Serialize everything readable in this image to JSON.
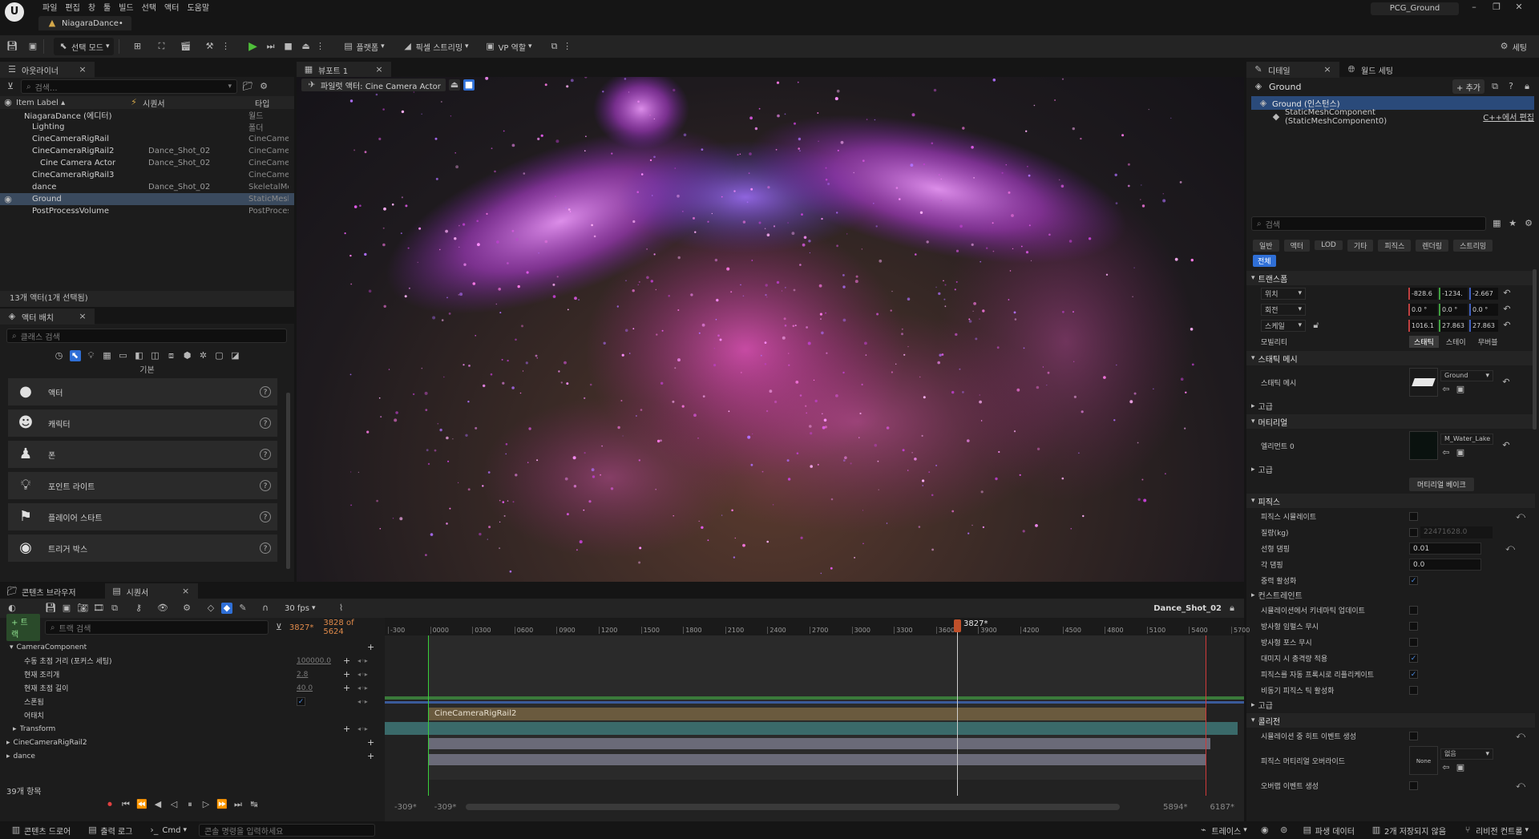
{
  "menu": {
    "items": [
      "파일",
      "편집",
      "창",
      "툴",
      "빌드",
      "선택",
      "액터",
      "도움말"
    ],
    "project": "PCG_Ground",
    "map_tab": "NiagaraDance•"
  },
  "toolbar": {
    "select_mode": "선택 모드",
    "platforms": "플랫폼",
    "pixel_streaming": "픽셀 스트리밍",
    "vp_role": "VP 역할",
    "settings": "세팅"
  },
  "outliner": {
    "tab": "아웃라이너",
    "search_placeholder": "검색...",
    "col_label": "Item Label ▴",
    "col_sequencer": "시퀀서",
    "col_type": "타입",
    "rows": [
      {
        "label": "NiagaraDance (에디터)",
        "seq": "",
        "type": "월드",
        "indent": 0,
        "selected": false
      },
      {
        "label": "Lighting",
        "seq": "",
        "type": "폴더",
        "indent": 1,
        "selected": false
      },
      {
        "label": "CineCameraRigRail",
        "seq": "",
        "type": "CineCamera",
        "indent": 1,
        "selected": false
      },
      {
        "label": "CineCameraRigRail2",
        "seq": "Dance_Shot_02",
        "type": "CineCamera",
        "indent": 1,
        "selected": false
      },
      {
        "label": "Cine Camera Actor",
        "seq": "Dance_Shot_02",
        "type": "CineCamera",
        "indent": 2,
        "selected": false
      },
      {
        "label": "CineCameraRigRail3",
        "seq": "",
        "type": "CineCamera",
        "indent": 1,
        "selected": false
      },
      {
        "label": "dance",
        "seq": "Dance_Shot_02",
        "type": "SkeletalMe",
        "indent": 1,
        "selected": false
      },
      {
        "label": "Ground",
        "seq": "",
        "type": "StaticMesh",
        "indent": 1,
        "selected": true
      },
      {
        "label": "PostProcessVolume",
        "seq": "",
        "type": "PostProces",
        "indent": 1,
        "selected": false
      }
    ],
    "status": "13개 액터(1개 선택됨)"
  },
  "place_actors": {
    "tab": "액터 배치",
    "search_placeholder": "클래스 검색",
    "category": "기본",
    "items": [
      "액터",
      "캐릭터",
      "폰",
      "포인트 라이트",
      "플레이어 스타트",
      "트리거 박스"
    ]
  },
  "viewport": {
    "tab": "뷰포트 1",
    "pilot_label": "파일럿 액터: Cine Camera Actor"
  },
  "details": {
    "tab": "디테일",
    "tab2": "월드 세팅",
    "actor_name": "Ground",
    "add_label": "+ 추가",
    "instance": "Ground (인스턴스)",
    "component": "StaticMeshComponent (StaticMeshComponent0)",
    "cpp_link": "C++에서 편집",
    "search_placeholder": "검색",
    "filters": [
      "일반",
      "액터",
      "LOD",
      "기타",
      "피직스",
      "렌더링",
      "스트리밍"
    ],
    "filter_all": "전체",
    "sections": {
      "transform": "트랜스폼",
      "location": "위치",
      "rotation": "회전",
      "scale": "스케일",
      "mobility": "모빌리티",
      "mobility_opts": [
        "스태틱",
        "스테이",
        "무버블"
      ],
      "static_mesh_section": "스태틱 메시",
      "static_mesh": "스태틱 메시",
      "mesh_value": "Ground",
      "advanced": "고급",
      "material_section": "머티리얼",
      "element0": "엘리먼트 0",
      "material_value": "M_Water_Lake",
      "advanced2": "고급",
      "bake": "머티리얼 베이크",
      "physics": "피직스",
      "simulate": "피직스 시뮬레이트",
      "mass": "질량(kg)",
      "mass_value": "22471628.0",
      "linear_damping": "선형 댐핑",
      "linear_damping_value": "0.01",
      "angular_damping": "각 댐핑",
      "angular_damping_value": "0.0",
      "gravity": "중력 활성화",
      "constraints": "컨스트레인트",
      "kinematic": "시뮬레이션에서 키네마틱 업데이트",
      "ignore_radial_impulse": "방사형 임펄스 무시",
      "ignore_radial_force": "방사형 포스 무시",
      "apply_impulse": "대미지 시 충격량 적용",
      "replicate": "피직스를 자동 프록시로 리플리케이트",
      "async_tick": "비동기 피직스 틱 활성화",
      "advanced3": "고급",
      "collision": "콜리전",
      "hit_events": "시뮬레이션 중 히트 이벤트 생성",
      "phys_mat": "피직스 머티리얼 오버라이드",
      "phys_mat_value": "없음",
      "phys_mat_thumb": "None",
      "overlap": "오버랩 이벤트 생성"
    },
    "location_vals": [
      "-828.6",
      "-1234.",
      "-2.667"
    ],
    "rotation_vals": [
      "0.0 °",
      "0.0 °",
      "0.0 °"
    ],
    "scale_vals": [
      "1016.1",
      "27.863",
      "27.863"
    ]
  },
  "bottom_tabs": {
    "content_browser": "콘텐츠 브라우저",
    "sequencer": "시퀀서"
  },
  "sequencer": {
    "fps": "30 fps",
    "shot_name": "Dance_Shot_02",
    "add_track": "+ 트랙",
    "search_placeholder": "트랙 검색",
    "current_frame": "3827*",
    "frame_count": "3828 of 5624",
    "playhead_label": "3827*",
    "ruler_ticks": [
      "-300",
      "0000",
      "0300",
      "0600",
      "0900",
      "1200",
      "1500",
      "1800",
      "2100",
      "2400",
      "2700",
      "3000",
      "3300",
      "3600",
      "3900",
      "4200",
      "4500",
      "4800",
      "5100",
      "5400",
      "5700"
    ],
    "tracks": [
      {
        "label": "CameraComponent",
        "value": "",
        "kind": "header"
      },
      {
        "label": "수동 초점 거리 (포커스 세팅)",
        "value": "100000.0",
        "kind": "prop"
      },
      {
        "label": "현재 조리개",
        "value": "2.8",
        "kind": "prop"
      },
      {
        "label": "현재 초점 길이",
        "value": "40.0",
        "kind": "prop"
      },
      {
        "label": "스폰됨",
        "value": "",
        "kind": "check"
      },
      {
        "label": "어태치",
        "value": "",
        "kind": "plain"
      },
      {
        "label": "Transform",
        "value": "",
        "kind": "prop2"
      },
      {
        "label": "CineCameraRigRail2",
        "value": "",
        "kind": "header2"
      },
      {
        "label": "dance",
        "value": "",
        "kind": "header2"
      }
    ],
    "attach_clip": "CineCameraRigRail2",
    "item_count": "39개 항목",
    "range_start": "-309*",
    "range_start2": "-309*",
    "range_end": "5894*",
    "range_end2": "6187*"
  },
  "statusbar": {
    "content_drawer": "콘텐츠 드로어",
    "output_log": "출력 로그",
    "cmd": "Cmd",
    "cmd_placeholder": "콘솔 명령을 입력하세요",
    "trace": "트레이스",
    "derived_data": "파생 데이터",
    "unsaved": "2개 저장되지 않음",
    "revision": "리비전 컨트롤"
  }
}
